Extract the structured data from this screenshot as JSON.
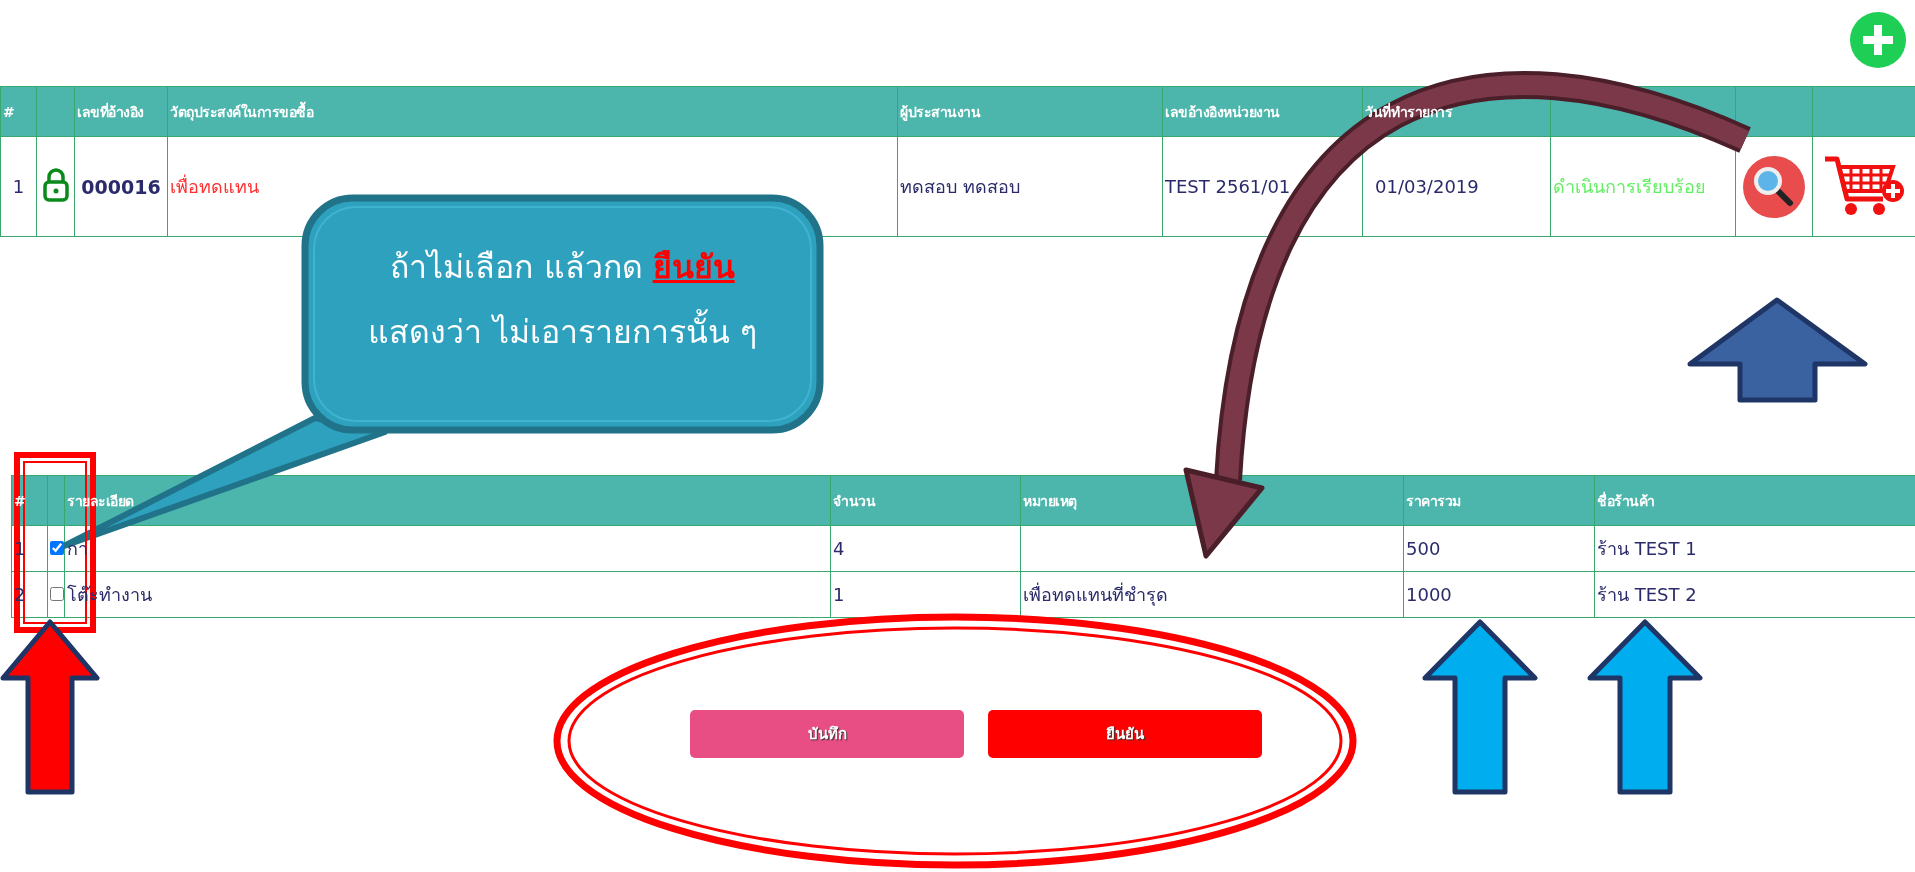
{
  "top_table": {
    "columns": [
      {
        "kind": "text",
        "label": "#"
      },
      {
        "kind": "blank"
      },
      {
        "kind": "text",
        "label": "เลขที่อ้างอิง"
      },
      {
        "kind": "text",
        "label": "วัตถุประสงค์ในการขอซื้อ"
      },
      {
        "kind": "text",
        "label": "ผู้ประสานงาน"
      },
      {
        "kind": "text",
        "label": "เลขอ้างอิงหน่วยงาน"
      },
      {
        "kind": "text",
        "label": "วันที่ทำรายการ"
      },
      {
        "kind": "blank"
      },
      {
        "kind": "blank"
      },
      {
        "kind": "blank"
      }
    ],
    "rows": [
      {
        "index": "1",
        "locked": true,
        "ref": "000016",
        "purpose": "เพื่อทดแทน",
        "coordinator": "ทดสอบ ทดสอบ",
        "dept_ref": "TEST 2561/01",
        "date": "01/03/2019",
        "status": "ดำเนินการเรียบร้อย"
      }
    ]
  },
  "callout": {
    "lines": [
      "ถ้าไม่เลือก แล้วกด **ยืนยัน**",
      "แสดงว่า ไม่เอารายการนั้น ๆ"
    ]
  },
  "item_table": {
    "columns": [
      {
        "kind": "text",
        "label": "#"
      },
      {
        "kind": "blank"
      },
      {
        "kind": "text",
        "label": "รายละเอียด"
      },
      {
        "kind": "text",
        "label": "จำนวน"
      },
      {
        "kind": "text",
        "label": "หมายเหตุ"
      },
      {
        "kind": "text",
        "label": "ราคารวม"
      },
      {
        "kind": "text",
        "label": "ชื่อร้านค้า"
      }
    ],
    "rows": [
      {
        "index": "1",
        "checked": true,
        "item": "กา",
        "qty": "4",
        "total": "500",
        "shop": "ร้าน TEST 1"
      },
      {
        "index": "2",
        "checked": false,
        "item": "โต๊ะทำงาน",
        "qty": "1",
        "note": "เพื่อทดแทนที่ชำรุด",
        "total": "1000",
        "shop": "ร้าน TEST 2"
      }
    ]
  },
  "buttons": [
    {
      "kind": "save",
      "label": "บันทึก"
    },
    {
      "kind": "confirm",
      "label": "ยืนยัน"
    }
  ]
}
